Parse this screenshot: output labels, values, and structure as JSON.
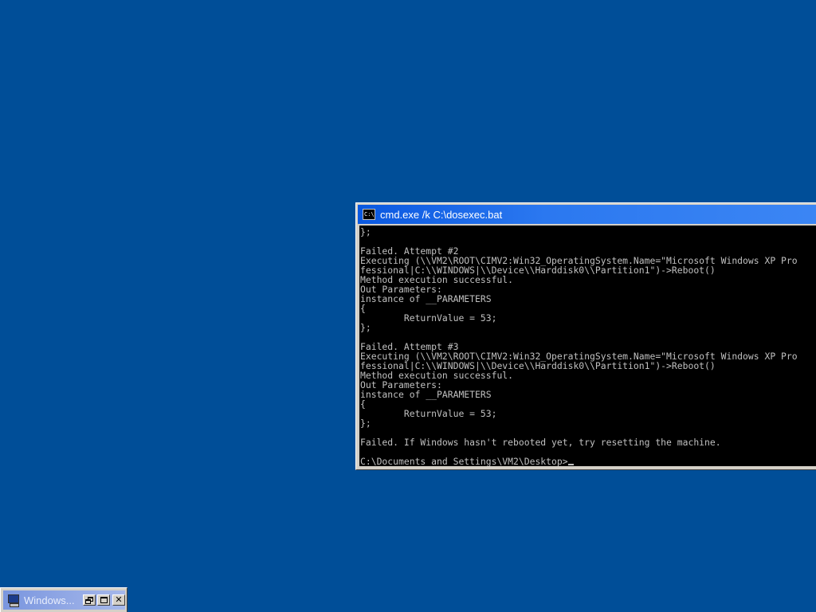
{
  "desktop": {
    "background_color": "#004e98"
  },
  "console": {
    "title": "cmd.exe /k C:\\dosexec.bat",
    "icon": "console-icon",
    "icon_text": "C:\\",
    "lines": [
      "};",
      "",
      "Failed. Attempt #2",
      "Executing (\\\\VM2\\ROOT\\CIMV2:Win32_OperatingSystem.Name=\"Microsoft Windows XP Pro",
      "fessional|C:\\\\WINDOWS|\\\\Device\\\\Harddisk0\\\\Partition1\")->Reboot()",
      "Method execution successful.",
      "Out Parameters:",
      "instance of __PARAMETERS",
      "{",
      "        ReturnValue = 53;",
      "};",
      "",
      "Failed. Attempt #3",
      "Executing (\\\\VM2\\ROOT\\CIMV2:Win32_OperatingSystem.Name=\"Microsoft Windows XP Pro",
      "fessional|C:\\\\WINDOWS|\\\\Device\\\\Harddisk0\\\\Partition1\")->Reboot()",
      "Method execution successful.",
      "Out Parameters:",
      "instance of __PARAMETERS",
      "{",
      "        ReturnValue = 53;",
      "};",
      "",
      "Failed. If Windows hasn't rebooted yet, try resetting the machine.",
      ""
    ],
    "prompt": "C:\\Documents and Settings\\VM2\\Desktop>"
  },
  "minimized_window": {
    "title": "Windows...",
    "icon": "computer-icon",
    "buttons": {
      "restore": "restore-icon",
      "maximize": "maximize-icon",
      "close": "close-icon",
      "close_glyph": "✕"
    }
  },
  "colors": {
    "title_bar_active": "#0a58e0",
    "title_bar_inactive": "#7a96df",
    "console_background": "#000000",
    "console_text": "#c0c0c0"
  }
}
